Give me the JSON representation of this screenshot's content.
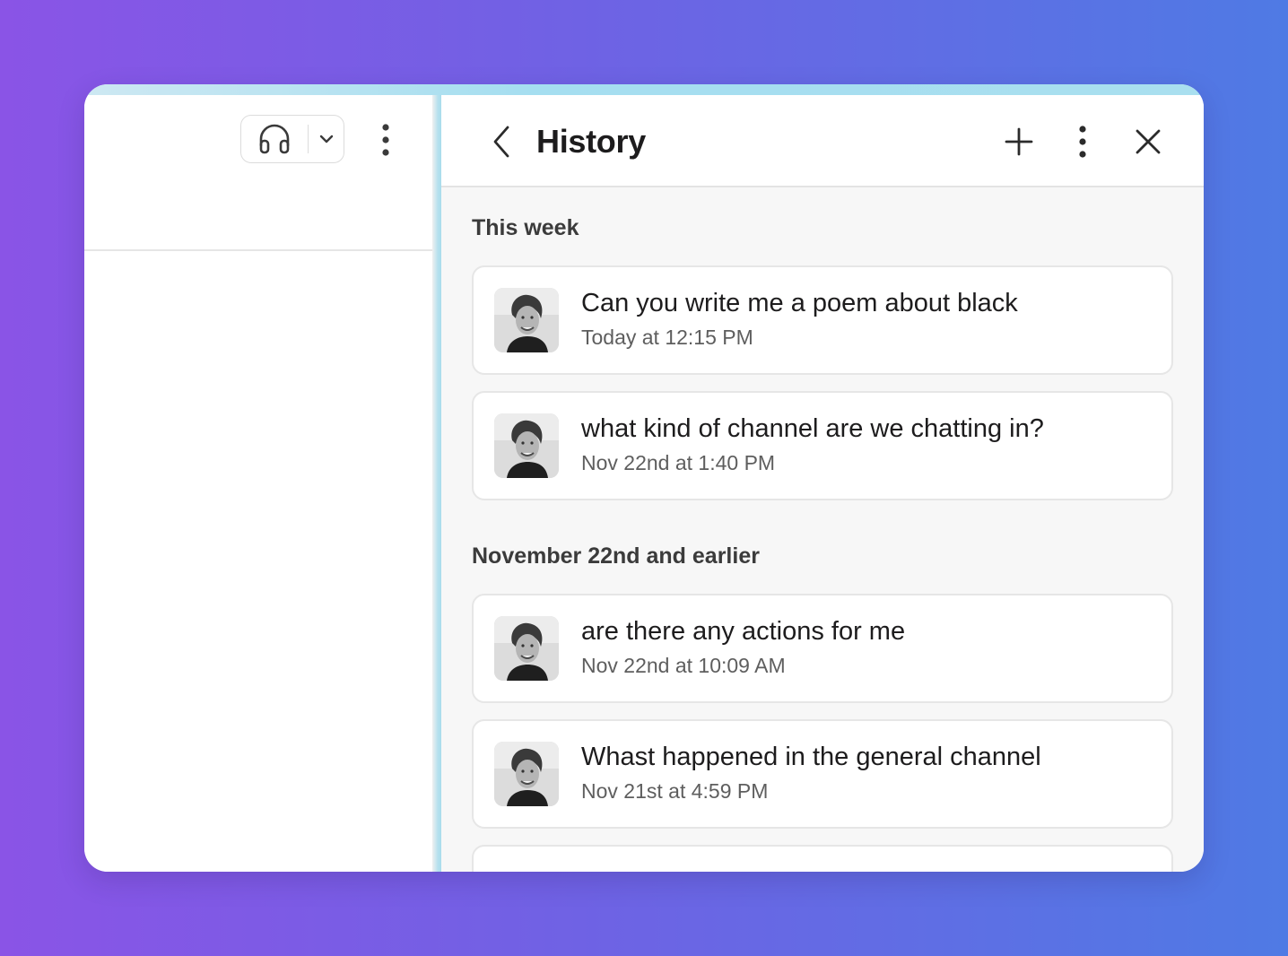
{
  "left_panel": {
    "headphone_icon": "headphones-icon",
    "dropdown_icon": "chevron-down-icon",
    "more_icon": "vertical-ellipsis-icon"
  },
  "history": {
    "title": "History",
    "back_icon": "chevron-left-icon",
    "new_icon": "plus-icon",
    "more_icon": "vertical-ellipsis-icon",
    "close_icon": "close-icon",
    "sections": [
      {
        "label": "This week",
        "items": [
          {
            "title": "Can you write me a poem about black",
            "time": "Today at 12:15 PM"
          },
          {
            "title": "what kind of channel are we chatting in?",
            "time": "Nov 22nd at 1:40 PM"
          }
        ]
      },
      {
        "label": "November 22nd and earlier",
        "items": [
          {
            "title": "are there any actions for me",
            "time": "Nov 22nd at 10:09 AM"
          },
          {
            "title": "Whast happened in the general channel",
            "time": "Nov 21st at 4:59 PM"
          }
        ]
      }
    ]
  },
  "colors": {
    "background_start": "#8a54e6",
    "background_end": "#4f7ae4",
    "accent_strip": "#a5def0",
    "title_text": "#1d1c1d",
    "secondary_text": "#5e5e5e"
  }
}
